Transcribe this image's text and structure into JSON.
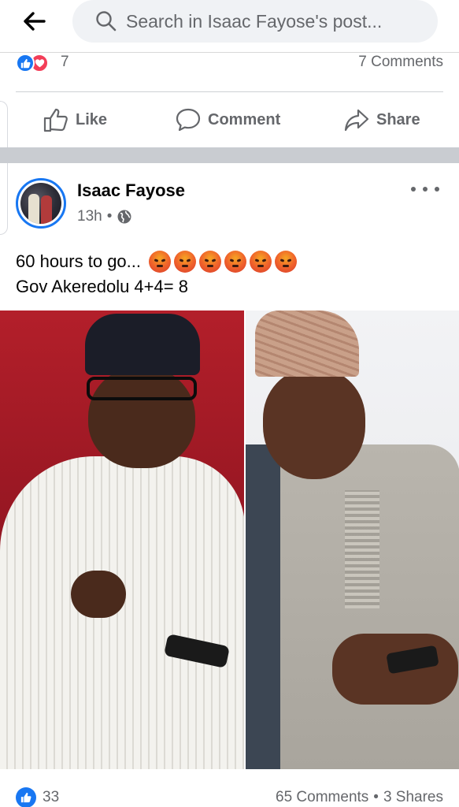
{
  "search": {
    "text": "Search in Isaac Fayose's post..."
  },
  "previous_post": {
    "reaction_count": "7",
    "comments": "7 Comments"
  },
  "actions": {
    "like": "Like",
    "comment": "Comment",
    "share": "Share"
  },
  "post": {
    "author": "Isaac Fayose",
    "time": "13h",
    "separator": "•",
    "line1": "60 hours to go...",
    "line2": "Gov Akeredolu 4+4= 8",
    "emoji_count": 6,
    "emoji": "angry-face"
  },
  "stats": {
    "likes": "33",
    "comments": "65 Comments",
    "separator": "•",
    "shares": "3 Shares"
  },
  "colors": {
    "accent": "#1877f2",
    "love": "#f33e58",
    "secondary_text": "#65676b"
  }
}
